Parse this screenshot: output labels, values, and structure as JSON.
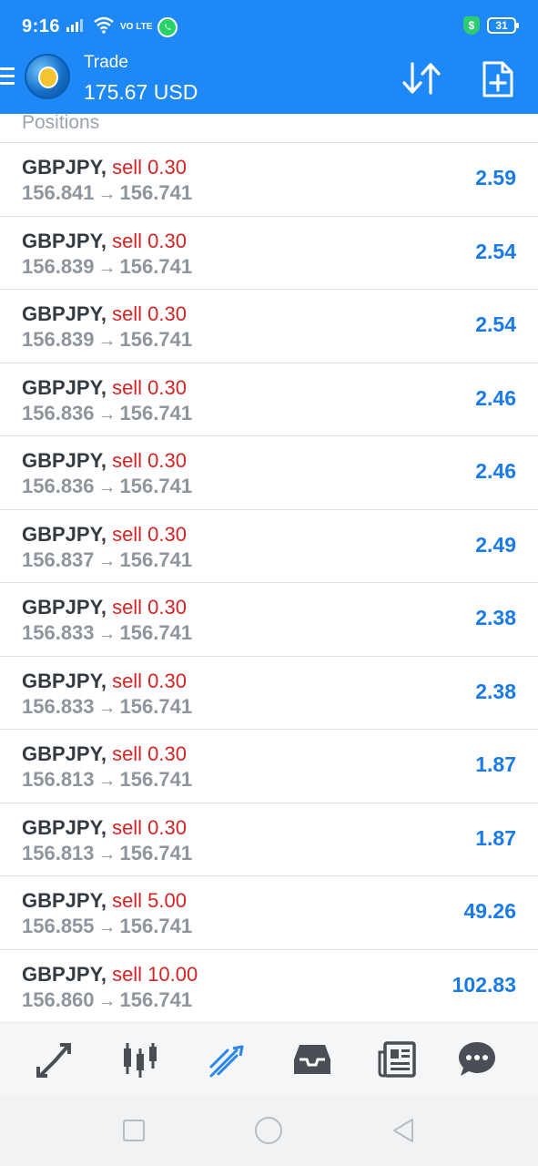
{
  "status_bar": {
    "time": "9:16",
    "network": "VO LTE",
    "battery": "31"
  },
  "header": {
    "title": "Trade",
    "balance": "175.67 USD"
  },
  "section": {
    "label": "Positions"
  },
  "positions": [
    {
      "symbol": "GBPJPY,",
      "side": "sell 0.30",
      "open": "156.841",
      "arrow": "→",
      "current": "156.741",
      "profit": "2.59"
    },
    {
      "symbol": "GBPJPY,",
      "side": "sell 0.30",
      "open": "156.839",
      "arrow": "→",
      "current": "156.741",
      "profit": "2.54"
    },
    {
      "symbol": "GBPJPY,",
      "side": "sell 0.30",
      "open": "156.839",
      "arrow": "→",
      "current": "156.741",
      "profit": "2.54"
    },
    {
      "symbol": "GBPJPY,",
      "side": "sell 0.30",
      "open": "156.836",
      "arrow": "→",
      "current": "156.741",
      "profit": "2.46"
    },
    {
      "symbol": "GBPJPY,",
      "side": "sell 0.30",
      "open": "156.836",
      "arrow": "→",
      "current": "156.741",
      "profit": "2.46"
    },
    {
      "symbol": "GBPJPY,",
      "side": "sell 0.30",
      "open": "156.837",
      "arrow": "→",
      "current": "156.741",
      "profit": "2.49"
    },
    {
      "symbol": "GBPJPY,",
      "side": "sell 0.30",
      "open": "156.833",
      "arrow": "→",
      "current": "156.741",
      "profit": "2.38"
    },
    {
      "symbol": "GBPJPY,",
      "side": "sell 0.30",
      "open": "156.833",
      "arrow": "→",
      "current": "156.741",
      "profit": "2.38"
    },
    {
      "symbol": "GBPJPY,",
      "side": "sell 0.30",
      "open": "156.813",
      "arrow": "→",
      "current": "156.741",
      "profit": "1.87"
    },
    {
      "symbol": "GBPJPY,",
      "side": "sell 0.30",
      "open": "156.813",
      "arrow": "→",
      "current": "156.741",
      "profit": "1.87"
    },
    {
      "symbol": "GBPJPY,",
      "side": "sell 5.00",
      "open": "156.855",
      "arrow": "→",
      "current": "156.741",
      "profit": "49.26"
    },
    {
      "symbol": "GBPJPY,",
      "side": "sell 10.00",
      "open": "156.860",
      "arrow": "→",
      "current": "156.741",
      "profit": "102.83"
    }
  ],
  "bottom_nav": [
    {
      "icon": "quotes-icon",
      "active": false
    },
    {
      "icon": "chart-icon",
      "active": false
    },
    {
      "icon": "trade-icon",
      "active": true
    },
    {
      "icon": "history-icon",
      "active": false
    },
    {
      "icon": "news-icon",
      "active": false
    },
    {
      "icon": "messages-icon",
      "active": false
    }
  ],
  "colors": {
    "header_bg": "#1e88f6",
    "sell": "#d42323",
    "profit": "#1a7be6",
    "nav_active": "#2a86e8",
    "nav_inactive": "#4a4f55"
  }
}
